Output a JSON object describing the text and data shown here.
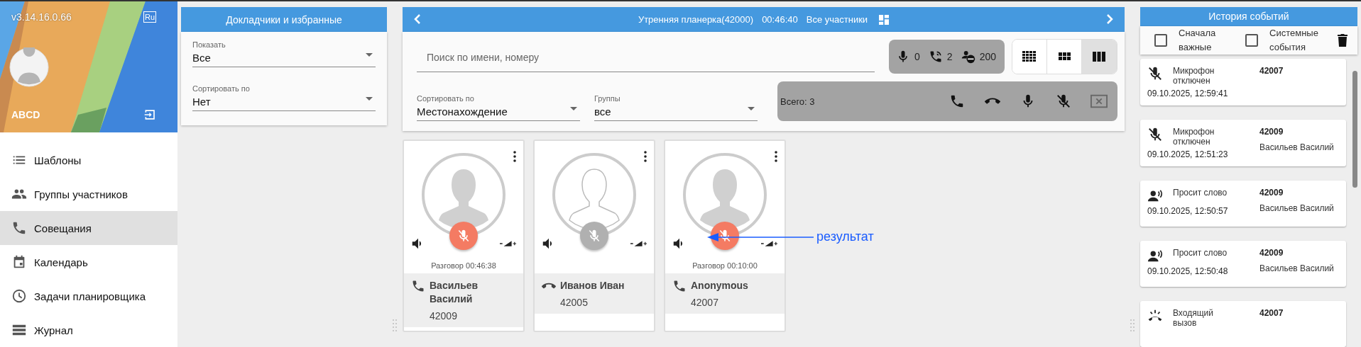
{
  "sidebar": {
    "version": "v3.14.16.0.66",
    "language": "Ru",
    "user": "ABCD",
    "items": [
      {
        "label": "Шаблоны",
        "kind": "list",
        "selected": false
      },
      {
        "label": "Группы участников",
        "kind": "people",
        "selected": false
      },
      {
        "label": "Совещания",
        "kind": "phone",
        "selected": true
      },
      {
        "label": "Календарь",
        "kind": "calendar",
        "selected": false
      },
      {
        "label": "Задачи планировщика",
        "kind": "clock",
        "selected": false
      },
      {
        "label": "Журнал",
        "kind": "journal",
        "selected": false
      }
    ]
  },
  "favorites_panel": {
    "title": "Докладчики и избранные",
    "fields": [
      {
        "label": "Показать",
        "value": "Все"
      },
      {
        "label": "Сортировать по",
        "value": "Нет"
      }
    ]
  },
  "conference": {
    "title": "Утренняя планерка(42000)",
    "duration": "00:46:40",
    "view": "Все участники",
    "search": {
      "placeholder": "Поиск по имени, номеру"
    },
    "stats": [
      {
        "kind": "mic",
        "value": "0"
      },
      {
        "kind": "calls",
        "value": "2"
      },
      {
        "kind": "max",
        "value": "200"
      }
    ],
    "layouts": [
      {
        "kind": "small",
        "selected": false
      },
      {
        "kind": "medium",
        "selected": false
      },
      {
        "kind": "large",
        "selected": true
      }
    ],
    "filters": [
      {
        "label": "Сортировать по",
        "value": "Местонахождение"
      },
      {
        "label": "Группы",
        "value": "все"
      }
    ],
    "total": "Всего: 3",
    "participants": [
      {
        "name": "Васильев Василий",
        "number": "42009",
        "status": "Разговор 00:46:38",
        "kind": "connected",
        "muted": true
      },
      {
        "name": "Иванов Иван",
        "number": "42005",
        "kind": "ended",
        "muted": false
      },
      {
        "name": "Anonymous",
        "number": "42007",
        "status": "Разговор 00:10:00",
        "kind": "connected",
        "muted": true
      }
    ]
  },
  "annotation": {
    "text": "результат"
  },
  "history": {
    "title": "История событий",
    "options": [
      {
        "label": "Сначала важные",
        "checked": false
      },
      {
        "label": "Системные события",
        "checked": false
      }
    ],
    "events": [
      {
        "kind": "mic_off",
        "label": "Микрофон отключен",
        "time": "09.10.2025, 12:59:41",
        "number": "42007"
      },
      {
        "kind": "mic_off",
        "label": "Микрофон отключен",
        "time": "09.10.2025, 12:51:23",
        "number": "42009",
        "name": "Васильев Василий"
      },
      {
        "kind": "hand",
        "label": "Просит слово",
        "time": "09.10.2025, 12:50:57",
        "number": "42009",
        "name": "Васильев Василий"
      },
      {
        "kind": "hand",
        "label": "Просит слово",
        "time": "09.10.2025, 12:50:48",
        "number": "42009",
        "name": "Васильев Василий"
      },
      {
        "kind": "incoming",
        "label": "Входящий вызов",
        "number": "42007"
      }
    ]
  }
}
